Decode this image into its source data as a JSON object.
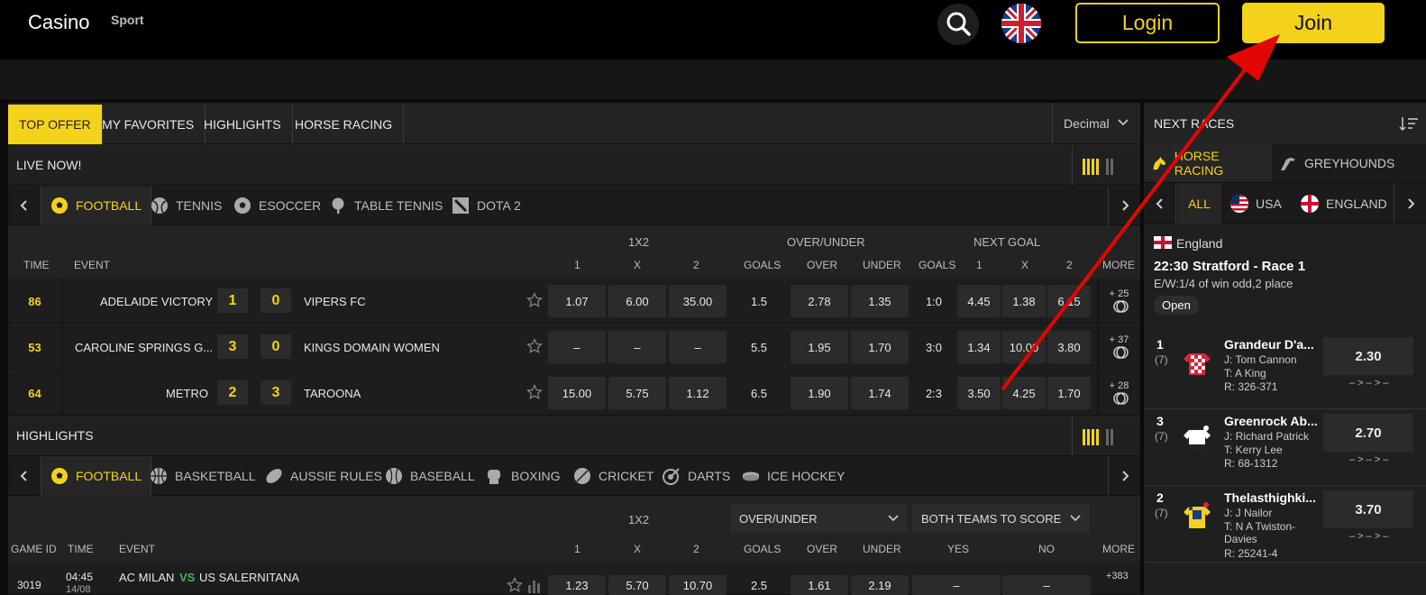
{
  "header": {
    "brand_casino": "Casino",
    "brand_sport": "Sport",
    "login_label": "Login",
    "join_label": "Join",
    "accent_color": "#f4d21b"
  },
  "tabs": [
    "TOP OFFER",
    "MY FAVORITES",
    "HIGHLIGHTS",
    "HORSE RACING"
  ],
  "odds_format": "Decimal",
  "live": {
    "title": "LIVE NOW!",
    "sports": [
      "FOOTBALL",
      "TENNIS",
      "ESOCCER",
      "TABLE TENNIS",
      "DOTA 2"
    ],
    "group_headers": [
      "1X2",
      "OVER/UNDER",
      "NEXT GOAL"
    ],
    "columns": [
      "TIME",
      "EVENT",
      "1",
      "X",
      "2",
      "GOALS",
      "OVER",
      "UNDER",
      "GOALS",
      "1",
      "X",
      "2",
      "MORE"
    ],
    "rows": [
      {
        "minute": "86",
        "home": "ADELAIDE VICTORY",
        "home_score": "1",
        "away_score": "0",
        "away": "VIPERS FC",
        "o1": "1.07",
        "ox": "6.00",
        "o2": "35.00",
        "ou_goals": "1.5",
        "over": "2.78",
        "under": "1.35",
        "ng_goals": "1:0",
        "ng1": "4.45",
        "ngx": "1.38",
        "ng2": "6.15",
        "more": "+ 25"
      },
      {
        "minute": "53",
        "home": "CAROLINE SPRINGS G...",
        "home_score": "3",
        "away_score": "0",
        "away": "KINGS DOMAIN WOMEN",
        "o1": "–",
        "ox": "–",
        "o2": "–",
        "ou_goals": "5.5",
        "over": "1.95",
        "under": "1.70",
        "ng_goals": "3:0",
        "ng1": "1.34",
        "ngx": "10.00",
        "ng2": "3.80",
        "more": "+ 37"
      },
      {
        "minute": "64",
        "home": "METRO",
        "home_score": "2",
        "away_score": "3",
        "away": "TAROONA",
        "o1": "15.00",
        "ox": "5.75",
        "o2": "1.12",
        "ou_goals": "6.5",
        "over": "1.90",
        "under": "1.74",
        "ng_goals": "2:3",
        "ng1": "3.50",
        "ngx": "4.25",
        "ng2": "1.70",
        "more": "+ 28"
      }
    ]
  },
  "highlights": {
    "title": "HIGHLIGHTS",
    "sports": [
      "FOOTBALL",
      "BASKETBALL",
      "AUSSIE RULES",
      "BASEBALL",
      "BOXING",
      "CRICKET",
      "DARTS",
      "ICE HOCKEY"
    ],
    "group_header": "1X2",
    "dropdown_1": "OVER/UNDER",
    "dropdown_2": "BOTH TEAMS TO SCORE",
    "columns": [
      "GAME ID",
      "TIME",
      "EVENT",
      "1",
      "X",
      "2",
      "GOALS",
      "OVER",
      "UNDER",
      "YES",
      "NO",
      "MORE"
    ],
    "row": {
      "game_id": "3019",
      "time": "04:45",
      "date": "14/08",
      "home": "AC MILAN",
      "vs": "VS",
      "away": "US SALERNITANA",
      "o1": "1.23",
      "ox": "5.70",
      "o2": "10.70",
      "goals": "2.5",
      "over": "1.61",
      "under": "2.19",
      "yes": "–",
      "no": "–",
      "more": "+383"
    }
  },
  "side": {
    "title": "NEXT RACES",
    "race_tabs": [
      "HORSE RACING",
      "GREYHOUNDS"
    ],
    "countries": [
      "ALL",
      "USA",
      "ENGLAND"
    ],
    "country": "England",
    "race_time": "22:30",
    "race_name": "Stratford - Race 1",
    "terms": "E/W:1/4 of win odd,2 place",
    "status": "Open",
    "runners": [
      {
        "num": "1",
        "draw": "(7)",
        "name": "Grandeur D'a...",
        "jockey": "J: Tom Cannon",
        "trainer": "T: A King",
        "rating": "R: 326-371",
        "price": "2.30",
        "form": "– > – > –"
      },
      {
        "num": "3",
        "draw": "(7)",
        "name": "Greenrock Ab...",
        "jockey": "J: Richard Patrick",
        "trainer": "T: Kerry Lee",
        "rating": "R: 68-1312",
        "price": "2.70",
        "form": "– > – > –"
      },
      {
        "num": "2",
        "draw": "(7)",
        "name": "Thelasthighki...",
        "jockey": "J: J Nailor",
        "trainer": "T: N A Twiston-Davies",
        "rating": "R: 25241-4",
        "price": "3.70",
        "form": "– > – > –"
      }
    ]
  }
}
